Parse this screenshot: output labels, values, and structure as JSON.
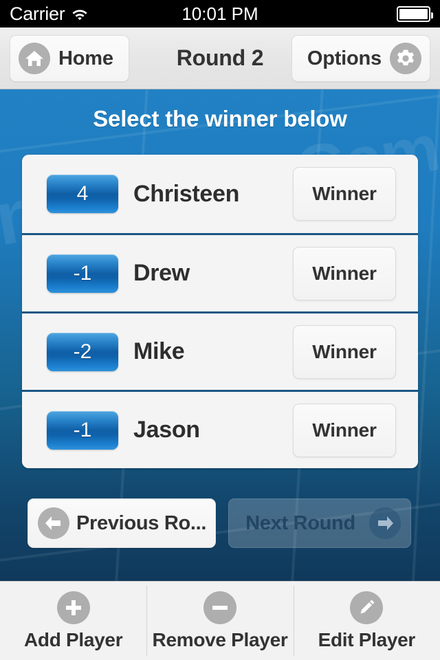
{
  "status_bar": {
    "carrier": "Carrier",
    "wifi_icon": "wifi-icon",
    "time": "10:01 PM",
    "battery_icon": "battery-full-icon"
  },
  "nav_bar": {
    "home_label": "Home",
    "home_icon": "home-icon",
    "title": "Round 2",
    "options_label": "Options",
    "options_icon": "gear-icon"
  },
  "board": {
    "instruction": "Select the winner below",
    "watermark": {
      "score": "Scor",
      "game": "Game",
      "edge": "n"
    },
    "colors": {
      "board_top": "#2181c4",
      "board_bottom": "#10395b",
      "separator": "#1b5685",
      "badge_light": "#4ea6e0",
      "badge_dark": "#0f5fa6"
    }
  },
  "players": [
    {
      "score": "4",
      "name": "Christeen",
      "winner_label": "Winner"
    },
    {
      "score": "-1",
      "name": "Drew",
      "winner_label": "Winner"
    },
    {
      "score": "-2",
      "name": "Mike",
      "winner_label": "Winner"
    },
    {
      "score": "-1",
      "name": "Jason",
      "winner_label": "Winner"
    }
  ],
  "round_nav": {
    "previous_label": "Previous Ro...",
    "previous_icon": "arrow-left-icon",
    "next_label": "Next Round",
    "next_icon": "arrow-right-icon",
    "next_disabled": true
  },
  "toolbar": [
    {
      "label": "Add Player",
      "icon": "plus-icon"
    },
    {
      "label": "Remove Player",
      "icon": "minus-icon"
    },
    {
      "label": "Edit Player",
      "icon": "pencil-icon"
    }
  ]
}
